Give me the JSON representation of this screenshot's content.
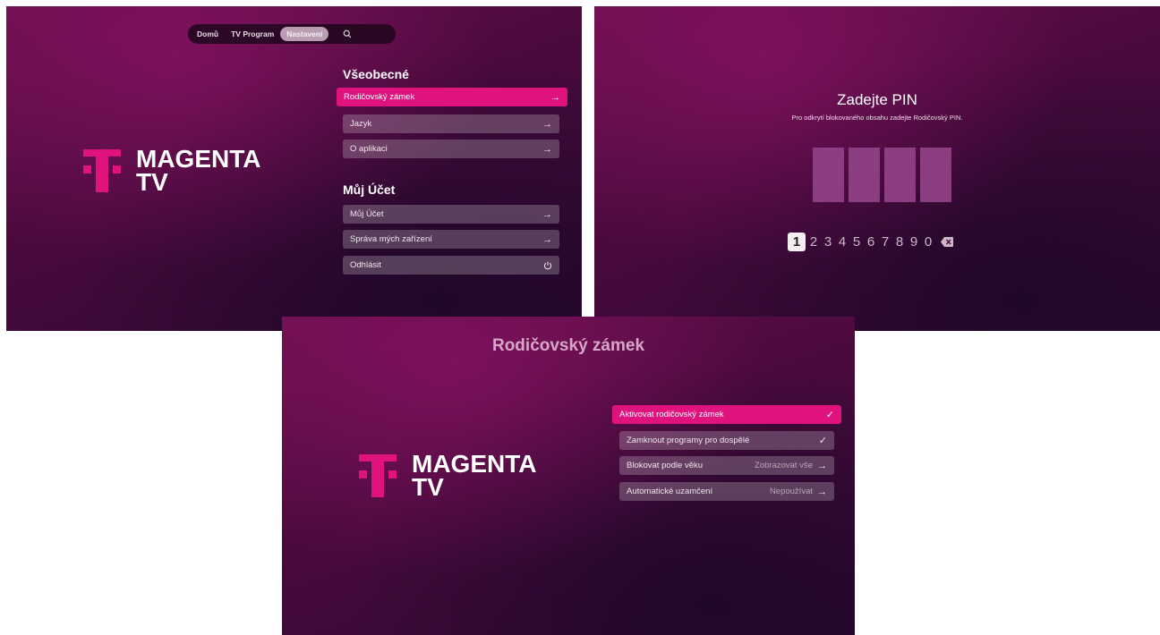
{
  "settings_screen": {
    "nav": {
      "items": [
        "Domů",
        "TV Program",
        "Nastavení"
      ],
      "active": "Nastavení",
      "search_icon": "search-icon"
    },
    "logo": {
      "line1": "MAGENTA",
      "line2": "TV"
    },
    "general": {
      "title": "Všeobecné",
      "items": [
        {
          "label": "Rodičovský zámek",
          "icon": "→"
        },
        {
          "label": "Jazyk",
          "icon": "→"
        },
        {
          "label": "O aplikaci",
          "icon": "→"
        }
      ]
    },
    "account": {
      "title": "Můj Účet",
      "items": [
        {
          "label": "Můj Účet",
          "icon": "→"
        },
        {
          "label": "Správa mých zařízení",
          "icon": "→"
        },
        {
          "label": "Odhlásit",
          "icon": "power-icon"
        }
      ]
    }
  },
  "pin_screen": {
    "title": "Zadejte PIN",
    "subtitle": "Pro odkrytí blokovaného obsahu zadejte Rodičovský PIN.",
    "digits": [
      "1",
      "2",
      "3",
      "4",
      "5",
      "6",
      "7",
      "8",
      "9",
      "0"
    ],
    "selected_digit": "1",
    "delete_icon": "backspace-icon"
  },
  "parental_screen": {
    "title": "Rodičovský zámek",
    "logo": {
      "line1": "MAGENTA",
      "line2": "TV"
    },
    "items": [
      {
        "label": "Aktivovat rodičovský zámek",
        "value": "",
        "icon": "✓"
      },
      {
        "label": "Zamknout programy pro dospělé",
        "value": "",
        "icon": "✓"
      },
      {
        "label": "Blokovat podle věku",
        "value": "Zobrazovat vše",
        "icon": "→"
      },
      {
        "label": "Automatické uzamčení",
        "value": "Nepoužívat",
        "icon": "→"
      }
    ]
  },
  "colors": {
    "magenta": "#e0127d",
    "background": "#4a0a3c",
    "pin_box": "#8b3d82"
  }
}
